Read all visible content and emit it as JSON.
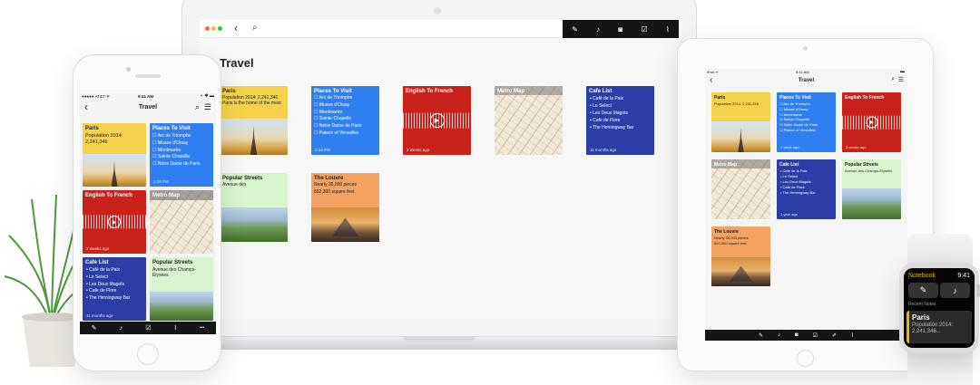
{
  "iphone": {
    "status": {
      "carrier": "●●●●● AT&T ᯤ",
      "time": "9:41 AM",
      "battery": "◐ ✱ ▬"
    },
    "title": "Travel",
    "notes": [
      {
        "title": "Paris",
        "body": "Population 2014:\n2,241,346"
      },
      {
        "title": "Places To Visit",
        "items": [
          "Arc de Triomphe",
          "Musee d'Orsay",
          "Montmartre",
          "Sainte Chapelle",
          "Notre Dame de Paris"
        ],
        "ago": "2:34 PM"
      },
      {
        "title": "English To French",
        "ago": "2 weeks ago"
      },
      {
        "title": "Metro Map"
      },
      {
        "title": "Cafe List",
        "items": [
          "Café de la Paix",
          "Le Select",
          "Les Deux Magots",
          "Cafe de Flore",
          "The Hemingway Bar"
        ],
        "ago": "11 months ago"
      },
      {
        "title": "Popular Streets",
        "body": "Avenue des Champs-\nÉlysées"
      }
    ],
    "toolbar_more": "•••"
  },
  "laptop": {
    "title": "Travel",
    "notes": [
      {
        "title": "Paris",
        "body": "Population 2014: 2,241,346\nParis is the home of the most"
      },
      {
        "title": "Places To Visit",
        "items": [
          "Arc de Triomphe",
          "Musee d'Orsay",
          "Montmartre",
          "Sainte Chapelle",
          "Notre Dame de Paris",
          "Palace of Versailles"
        ],
        "ago": "2:34 PM"
      },
      {
        "title": "English To French",
        "ago": "2 weeks ago"
      },
      {
        "title": "Metro Map"
      },
      {
        "title": "Cafe List",
        "items": [
          "Café de la Paix",
          "Le Select",
          "Les Deux Magots",
          "Cafe de Flore",
          "The Hemingway Bar"
        ],
        "ago": "11 months ago"
      },
      {
        "title": "Popular Streets",
        "body": "Avenue des"
      },
      {
        "title": "The Louvre",
        "body": "Nearly 35,000 pieces\n652,300 square feet"
      }
    ]
  },
  "ipad": {
    "status": {
      "device": "iPad ᯤ",
      "time": "9:41 AM",
      "battery": "▬"
    },
    "title": "Travel",
    "notes": [
      {
        "title": "Paris",
        "body": "Population 2014: 2,241,346"
      },
      {
        "title": "Places To Visit",
        "items": [
          "Arc de Triomphe",
          "Musee d'Orsay",
          "Montmartre",
          "Sainte Chapelle",
          "Notre Dame de Paris",
          "Palace of Versailles"
        ],
        "ago": "1 week ago"
      },
      {
        "title": "English To French",
        "ago": "3 weeks ago"
      },
      {
        "title": "Metro Map"
      },
      {
        "title": "Cafe List",
        "items": [
          "Café de la Paix",
          "Le Select",
          "Les Deux Magots",
          "Cafe de Flore",
          "The Hemingway Bar"
        ],
        "ago": "1 year ago"
      },
      {
        "title": "Popular Streets",
        "body": "Avenue des Champs-Élysées"
      },
      {
        "title": "The Louvre",
        "body": "Nearly 35,000 pieces\n652,300 square feet"
      }
    ]
  },
  "watch": {
    "app": "Notebook",
    "time": "9:41",
    "section": "Recent Notes",
    "note_title": "Paris",
    "note_body": "Population 2014:\n2,241,346..."
  },
  "colors": {
    "yellow": "#f6d24c",
    "blue": "#2f7ff0",
    "red": "#c9221b",
    "navy": "#2b3ea8",
    "green": "#d9f5cf",
    "orange": "#f4a261",
    "watch_accent": "#f0b400"
  }
}
